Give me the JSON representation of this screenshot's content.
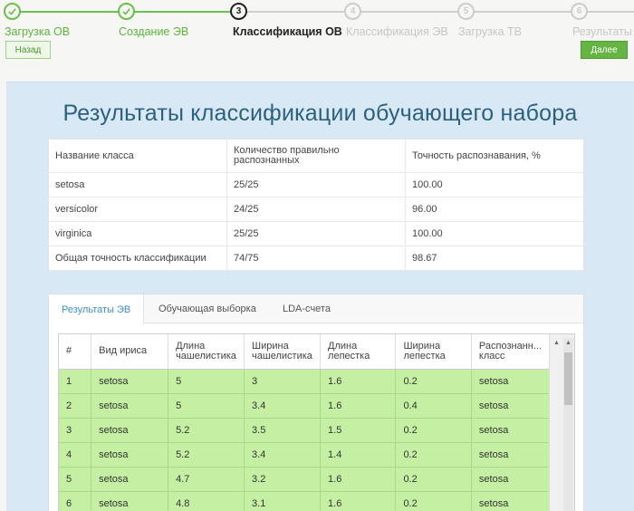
{
  "wizard": {
    "steps": [
      {
        "num": "1",
        "label": "Загрузка ОВ",
        "state": "done"
      },
      {
        "num": "2",
        "label": "Создание ЭВ",
        "state": "done"
      },
      {
        "num": "3",
        "label": "Классификация ОВ",
        "state": "active"
      },
      {
        "num": "4",
        "label": "Классификация ЭВ",
        "state": "todo"
      },
      {
        "num": "5",
        "label": "Загрузка ТВ",
        "state": "todo"
      },
      {
        "num": "6",
        "label": "Результаты",
        "state": "todo"
      }
    ],
    "back_label": "Назад",
    "next_label": "Далее"
  },
  "main": {
    "title": "Результаты классификации обучающего набора",
    "summary": {
      "headers": [
        "Название класса",
        "Количество правильно распознанных",
        "Точность распознавания, %"
      ],
      "rows": [
        [
          "setosa",
          "25/25",
          "100.00"
        ],
        [
          "versicolor",
          "24/25",
          "96.00"
        ],
        [
          "virginica",
          "25/25",
          "100.00"
        ],
        [
          "Общая точность классификации",
          "74/75",
          "98.67"
        ]
      ]
    },
    "tabs": [
      {
        "label": "Результаты ЭВ",
        "active": true
      },
      {
        "label": "Обучающая выборка",
        "active": false
      },
      {
        "label": "LDA-счета",
        "active": false
      }
    ],
    "grid": {
      "headers": [
        "#",
        "Вид ириса",
        "Длина чашелистика",
        "Ширина чашелистика",
        "Длина лепестка",
        "Ширина лепестка",
        "Распознанн... класс"
      ],
      "rows": [
        [
          "1",
          "setosa",
          "5",
          "3",
          "1.6",
          "0.2",
          "setosa"
        ],
        [
          "2",
          "setosa",
          "5",
          "3.4",
          "1.6",
          "0.4",
          "setosa"
        ],
        [
          "3",
          "setosa",
          "5.2",
          "3.5",
          "1.5",
          "0.2",
          "setosa"
        ],
        [
          "4",
          "setosa",
          "5.2",
          "3.4",
          "1.4",
          "0.2",
          "setosa"
        ],
        [
          "5",
          "setosa",
          "4.7",
          "3.2",
          "1.6",
          "0.2",
          "setosa"
        ],
        [
          "6",
          "setosa",
          "4.8",
          "3.1",
          "1.6",
          "0.2",
          "setosa"
        ]
      ]
    }
  },
  "colors": {
    "done": "#5db53c",
    "accent": "#2b617f",
    "row_highlight": "#c5f0a4",
    "tab_active": "#3a8fc8"
  }
}
